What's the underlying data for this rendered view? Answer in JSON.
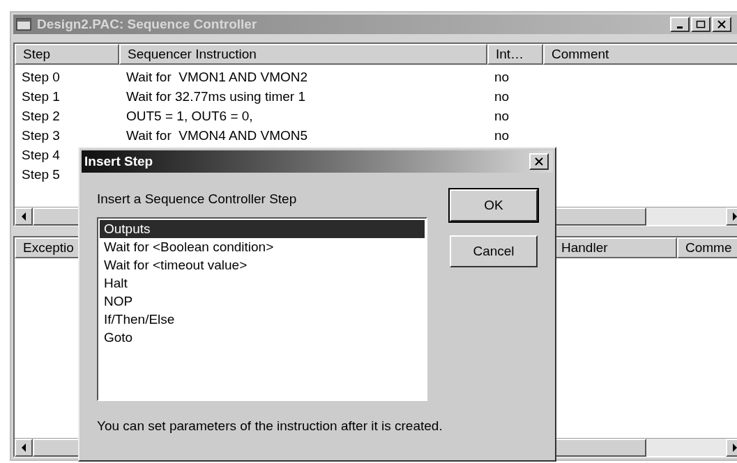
{
  "window": {
    "title": "Design2.PAC: Sequence Controller"
  },
  "steps_table": {
    "columns": [
      "Step",
      "Sequencer Instruction",
      "Int…",
      "Comment"
    ],
    "rows": [
      {
        "cells": [
          "Step 0",
          "Wait for  VMON1 AND VMON2",
          "no"
        ]
      },
      {
        "cells": [
          "Step 1",
          "Wait for 32.77ms using timer 1",
          "no"
        ]
      },
      {
        "cells": [
          "Step 2",
          "OUT5 = 1, OUT6 = 0,",
          "no"
        ]
      },
      {
        "cells": [
          "Step 3",
          "Wait for  VMON4 AND VMON5",
          "no"
        ]
      },
      {
        "cells": [
          "Step 4"
        ]
      },
      {
        "cells": [
          "Step 5"
        ]
      }
    ]
  },
  "exceptions_table": {
    "columns": [
      "Exceptio",
      "Handler",
      "Comme"
    ]
  },
  "dialog": {
    "title": "Insert Step",
    "prompt": "Insert a Sequence Controller Step",
    "buttons": [
      {
        "label": "OK",
        "default": true
      },
      {
        "label": "Cancel",
        "default": false
      }
    ],
    "items": [
      {
        "label": "Outputs",
        "selected": true
      },
      {
        "label": "Wait for <Boolean condition>",
        "selected": false
      },
      {
        "label": "Wait for <timeout value>",
        "selected": false
      },
      {
        "label": "Halt",
        "selected": false
      },
      {
        "label": "NOP",
        "selected": false
      },
      {
        "label": "If/Then/Else",
        "selected": false
      },
      {
        "label": "Goto",
        "selected": false
      }
    ],
    "footer": "You can set parameters of the instruction after it is created."
  }
}
